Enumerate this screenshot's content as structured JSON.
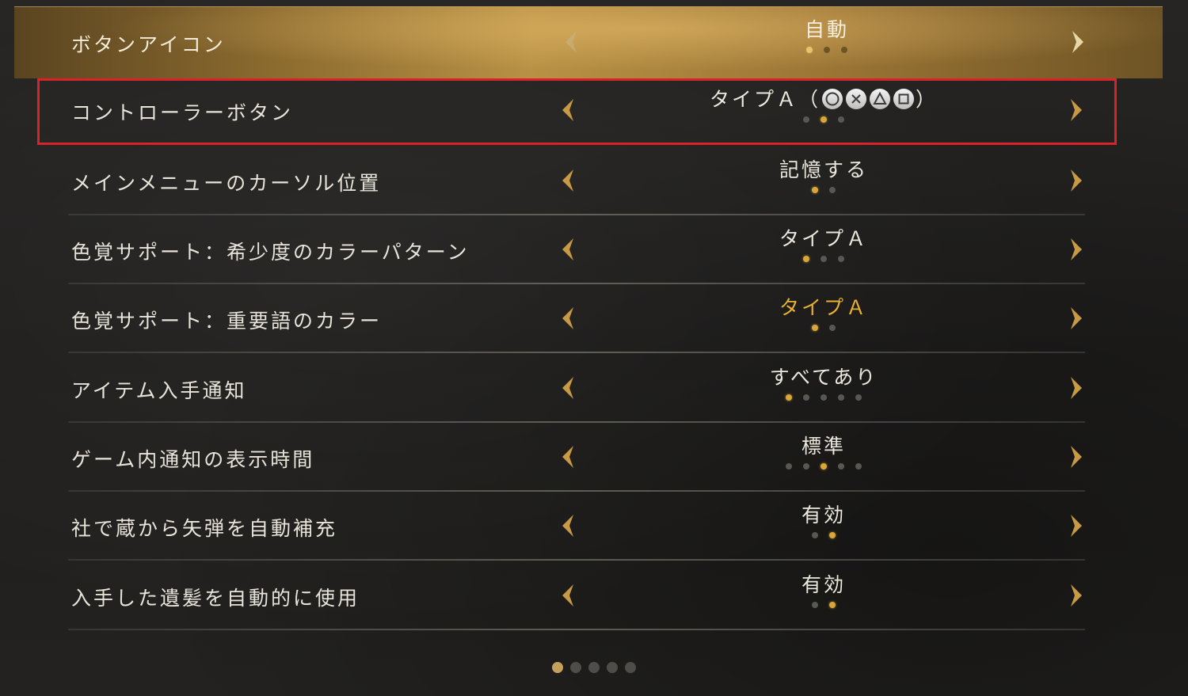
{
  "rows": [
    {
      "label": "ボタンアイコン",
      "value": "自動",
      "dots": 3,
      "active": 0
    },
    {
      "label": "コントローラーボタン",
      "value": "タイプＡ（",
      "value_end": "）",
      "dots": 3,
      "active": 1
    },
    {
      "label": "メインメニューのカーソル位置",
      "value": "記憶する",
      "dots": 2,
      "active": 0
    },
    {
      "label": "色覚サポート：希少度のカラーパターン",
      "value": "タイプＡ",
      "dots": 3,
      "active": 0
    },
    {
      "label": "色覚サポート：重要語のカラー",
      "value": "タイプＡ",
      "dots": 2,
      "active": 0
    },
    {
      "label": "アイテム入手通知",
      "value": "すべてあり",
      "dots": 5,
      "active": 0
    },
    {
      "label": "ゲーム内通知の表示時間",
      "value": "標準",
      "dots": 5,
      "active": 2
    },
    {
      "label": "社で蔵から矢弾を自動補充",
      "value": "有効",
      "dots": 2,
      "active": 1
    },
    {
      "label": "入手した遺髪を自動的に使用",
      "value": "有効",
      "dots": 2,
      "active": 1
    }
  ],
  "controller_glyphs": [
    "circle-button-icon",
    "cross-button-icon",
    "triangle-button-icon",
    "square-button-icon"
  ],
  "pager": {
    "pages": 5,
    "active": 0
  },
  "colors": {
    "accent": "#d9a63a",
    "highlight_text": "#e8b230",
    "focus_border": "#d8232a"
  }
}
